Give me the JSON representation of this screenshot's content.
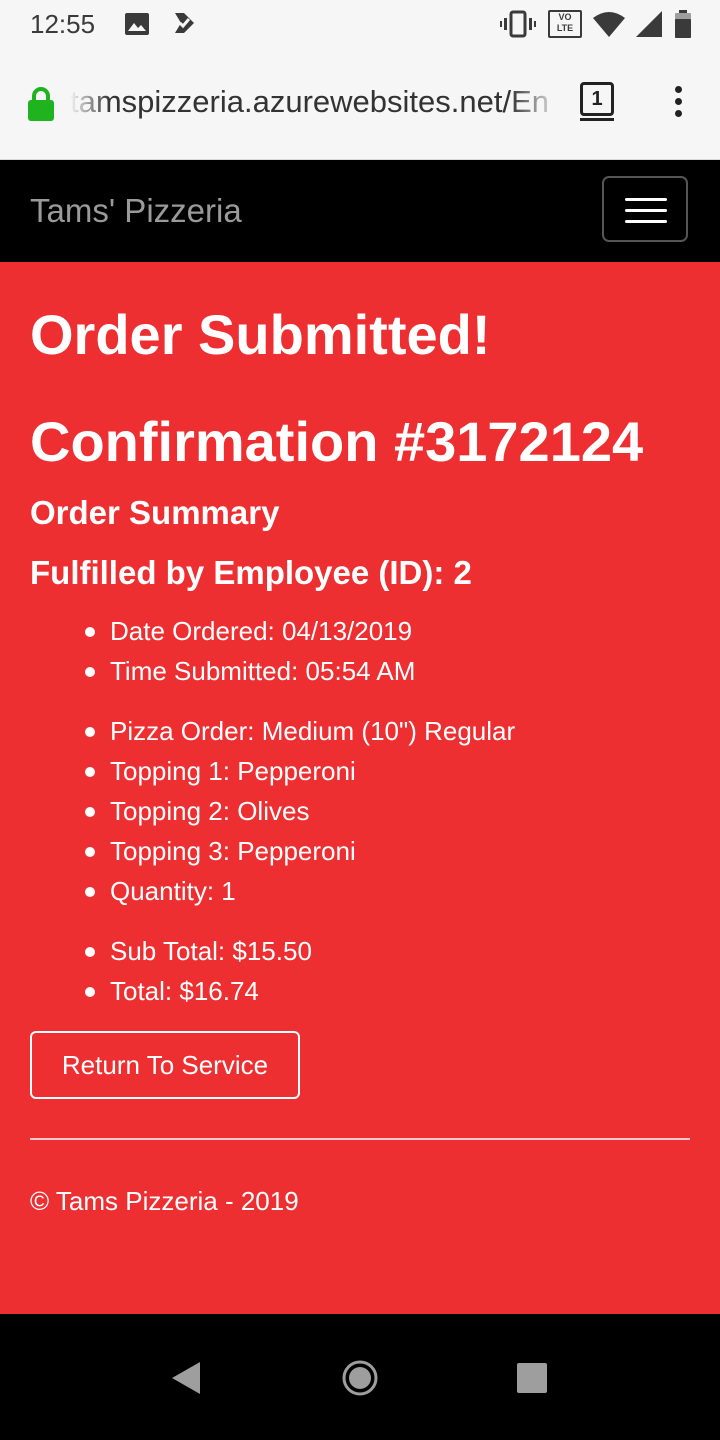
{
  "status_bar": {
    "time": "12:55",
    "icons": [
      "image-icon",
      "notification-icon",
      "vibrate-icon",
      "volte-icon",
      "wifi-icon",
      "signal-icon",
      "battery-icon"
    ],
    "volte_text": "VO LTE"
  },
  "browser": {
    "url": "tamspizzeria.azurewebsites.net/En",
    "tab_count": "1"
  },
  "navbar": {
    "brand": "Tams' Pizzeria"
  },
  "content": {
    "heading": "Order Submitted!",
    "confirmation": "Confirmation #3172124",
    "summary_title": "Order Summary",
    "fulfilled_by": "Fulfilled by Employee (ID): 2",
    "group1": [
      "Date Ordered: 04/13/2019",
      "Time Submitted: 05:54 AM"
    ],
    "group2": [
      "Pizza Order: Medium (10\") Regular",
      "Topping 1: Pepperoni",
      "Topping 2: Olives",
      "Topping 3: Pepperoni",
      "Quantity: 1"
    ],
    "group3": [
      "Sub Total: $15.50",
      "Total: $16.74"
    ],
    "return_button": "Return To Service",
    "footer": "© Tams Pizzeria - 2019"
  },
  "colors": {
    "page_background": "#ee2f32",
    "navbar_background": "#000000",
    "secure_lock": "#1fb31f"
  }
}
